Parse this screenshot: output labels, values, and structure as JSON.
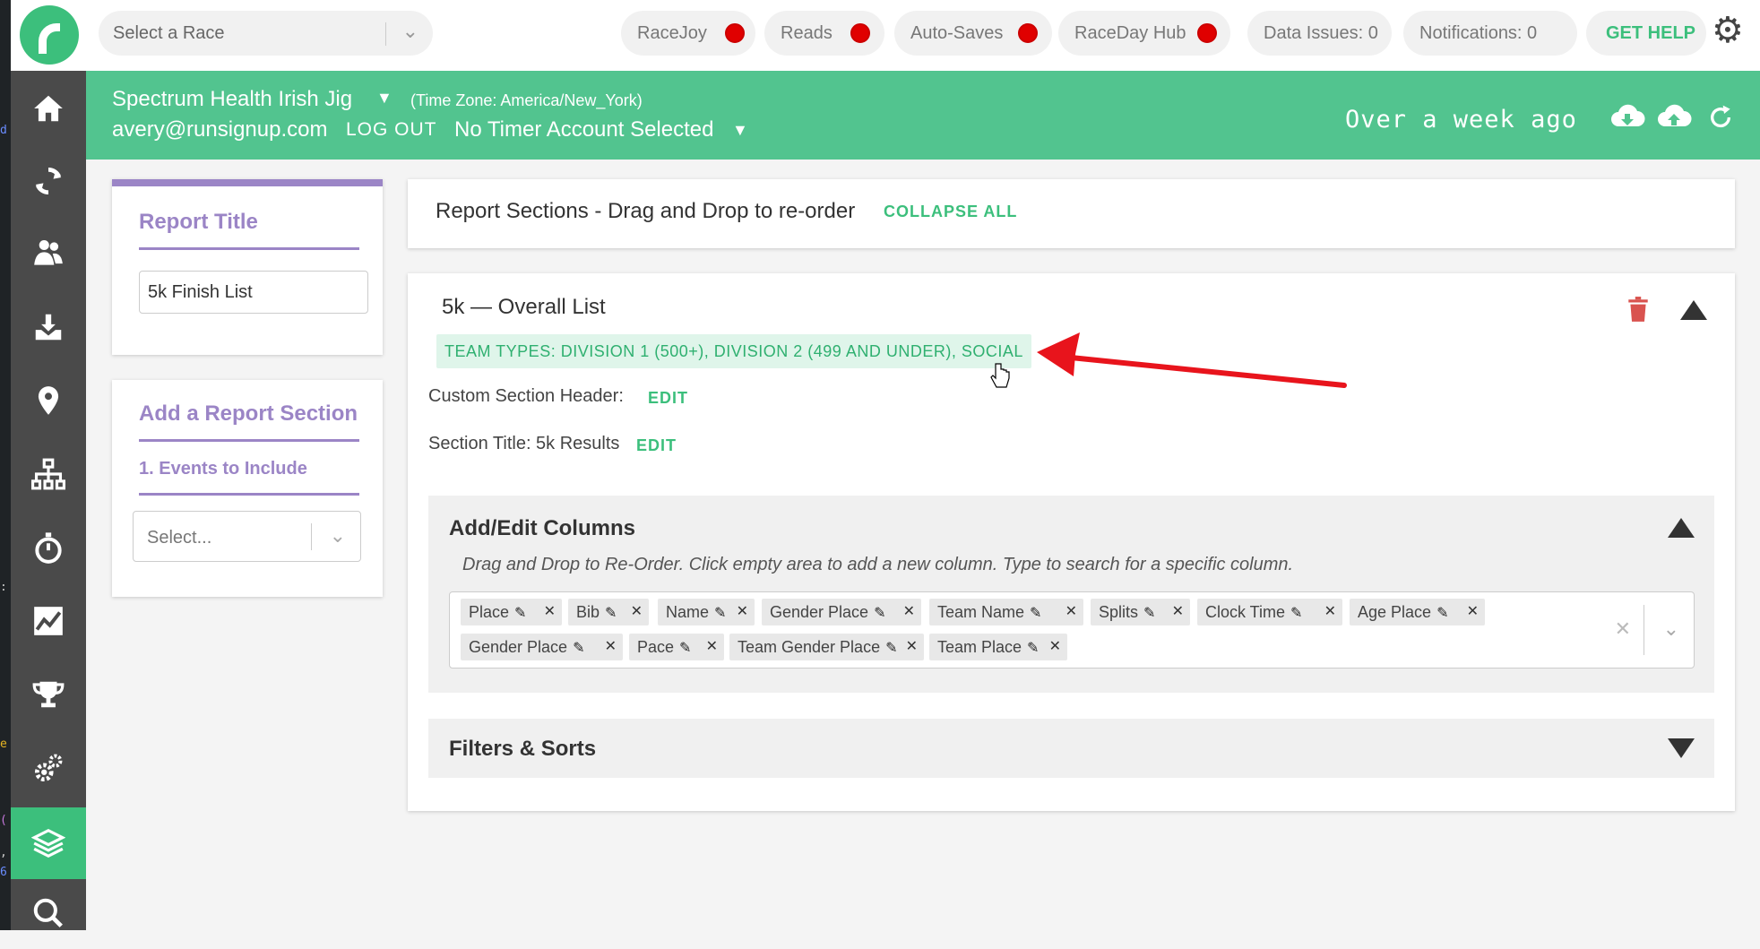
{
  "editor_strip": {
    "chars": [
      "d",
      ":",
      "",
      "e",
      "(",
      ",",
      "6"
    ]
  },
  "topbar": {
    "race_select_placeholder": "Select a Race",
    "status_pills": [
      {
        "label": "RaceJoy",
        "status": "red"
      },
      {
        "label": "Reads",
        "status": "red"
      },
      {
        "label": "Auto-Saves",
        "status": "red"
      },
      {
        "label": "RaceDay Hub",
        "status": "red"
      }
    ],
    "data_issues": "Data Issues: 0",
    "notifications": "Notifications: 0",
    "get_help": "GET HELP"
  },
  "sidebar": {
    "items": [
      "home-icon",
      "sync-icon",
      "participants-icon",
      "download-icon",
      "location-icon",
      "hierarchy-icon",
      "stopwatch-icon",
      "chart-icon",
      "trophy-icon",
      "settings-gears-icon",
      "layers-icon",
      "search-icon"
    ],
    "active": "layers-icon"
  },
  "header": {
    "race_name": "Spectrum Health Irish Jig",
    "timezone": "(Time Zone: America/New_York)",
    "user_email": "avery@runsignup.com",
    "logout": "LOG OUT",
    "timer_account": "No Timer Account Selected",
    "last_sync": "Over a week ago"
  },
  "report_title_card": {
    "heading": "Report Title",
    "value": "5k Finish List"
  },
  "add_section_card": {
    "heading": "Add a Report Section",
    "step": "1. Events to Include",
    "select_placeholder": "Select..."
  },
  "sections_card": {
    "title": "Report Sections - Drag and Drop to re-order",
    "collapse_all": "COLLAPSE ALL"
  },
  "section": {
    "title": "5k — Overall List",
    "team_types": "TEAM TYPES: DIVISION 1 (500+), DIVISION 2 (499 AND UNDER), SOCIAL",
    "custom_header_label": "Custom Section Header:",
    "section_title_label": "Section Title: 5k Results",
    "edit": "EDIT",
    "columns": {
      "title": "Add/Edit Columns",
      "hint": "Drag and Drop to Re-Order. Click empty area to add a new column. Type to search for a specific column.",
      "chips": [
        "Place",
        "Bib",
        "Name",
        "Gender Place",
        "Team Name",
        "Splits",
        "Clock Time",
        "Age Place",
        "Gender Place",
        "Pace",
        "Team Gender Place",
        "Team Place"
      ]
    },
    "filters_title": "Filters & Sorts"
  },
  "colors": {
    "brand_green": "#52c48f",
    "accent_purple": "#9b85c6",
    "status_red": "#e00000",
    "annotation_red": "#e8141c"
  }
}
